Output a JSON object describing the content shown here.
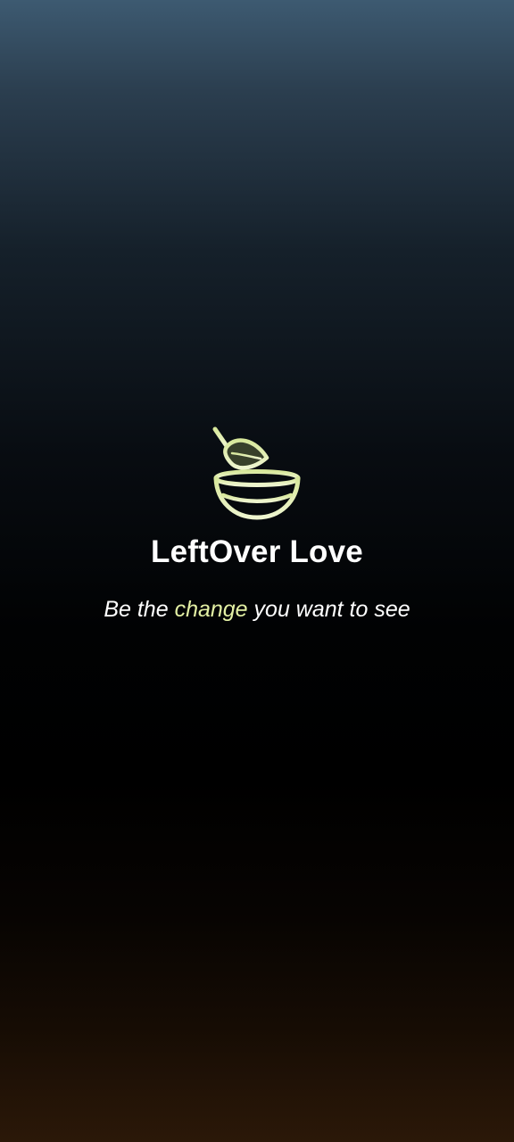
{
  "app": {
    "name": "LeftOver Love",
    "logo_icon": "leaf-bowl-icon"
  },
  "tagline": {
    "before": "Be the ",
    "highlight": "change",
    "after": " you want to see"
  },
  "colors": {
    "accent": "#e3f0a4",
    "text": "#ffffff",
    "gradient_top": "#3d5a71",
    "gradient_middle": "#000000",
    "gradient_bottom": "#2b1808"
  }
}
